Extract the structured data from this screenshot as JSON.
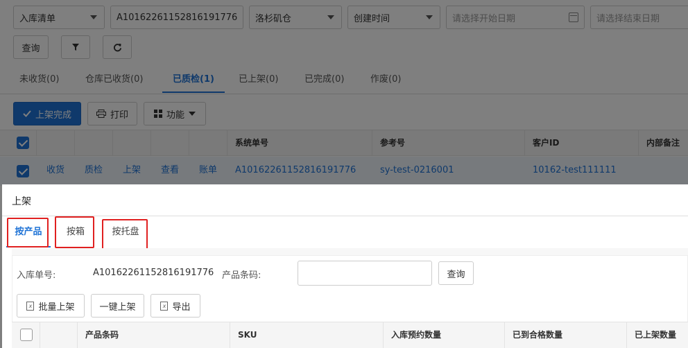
{
  "filters": {
    "type_select": "入库清单",
    "order_no": "A10162261152816191776",
    "warehouse_select": "洛杉矶仓",
    "time_select": "创建时间",
    "start_date_placeholder": "请选择开始日期",
    "end_date_placeholder": "请选择结束日期",
    "search_label": "查询"
  },
  "tabs": [
    "未收货(0)",
    "仓库已收货(0)",
    "已质检(1)",
    "已上架(0)",
    "已完成(0)",
    "作废(0)"
  ],
  "active_tab": "已质检(1)",
  "toolbar": {
    "shelve_done": "上架完成",
    "print": "打印",
    "functions": "功能"
  },
  "table": {
    "headers": [
      "系统单号",
      "参考号",
      "客户ID",
      "内部备注"
    ],
    "row": {
      "actions": [
        "收货",
        "质检",
        "上架",
        "查看",
        "账单"
      ],
      "system_no": "A10162261152816191776",
      "ref_no": "sy-test-0216001",
      "customer_id": "10162-test111111"
    }
  },
  "modal": {
    "title": "上架",
    "tabs": [
      "按产品",
      "按箱",
      "按托盘"
    ],
    "active_tab": "按产品",
    "order_label": "入库单号:",
    "order_value": "A10162261152816191776",
    "barcode_label": "产品条码:",
    "barcode_value": "",
    "search_label": "查询",
    "buttons": {
      "batch": "批量上架",
      "one_key": "一键上架",
      "export": "导出"
    },
    "headers": [
      "产品条码",
      "SKU",
      "入库预约数量",
      "已到合格数量",
      "已上架数量"
    ]
  },
  "colors": {
    "accent": "#1f73d6",
    "highlight_box": "#e02020"
  }
}
